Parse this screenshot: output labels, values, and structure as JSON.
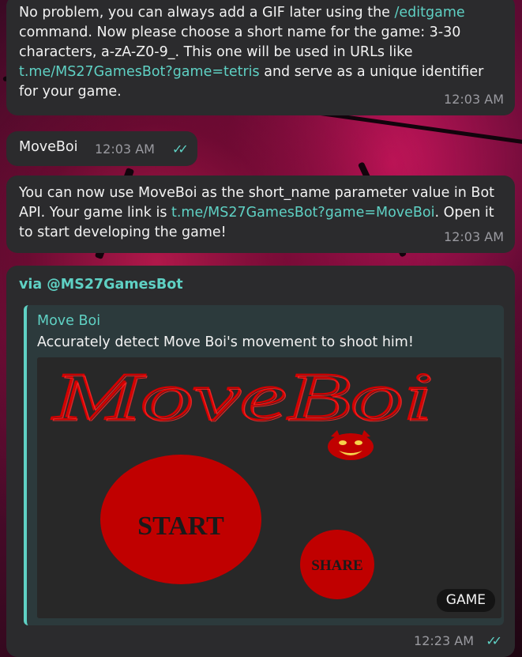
{
  "messages": [
    {
      "text_before": "No problem, you can always add a GIF later using the ",
      "link": "/editgame",
      "text_after": " command. Now please choose a short name for the game: 3-30 characters, a-zA-Z0-9_. This one will be used in URLs like ",
      "link2": "t.me/MS27GamesBot?game=tetris",
      "text_end": " and serve as a unique identifier for your game.",
      "time": "12:03 AM"
    },
    {
      "text": "MoveBoi",
      "time": "12:03 AM",
      "status": "read"
    },
    {
      "text_before": "You can now use MoveBoi as the short_name parameter value in Bot API. Your game link is ",
      "link": "t.me/MS27GamesBot?game=MoveBoi",
      "text_after": ". Open it to start developing the game!",
      "time": "12:03 AM"
    }
  ],
  "game_message": {
    "via": "via @MS27GamesBot",
    "title": "Move Boi",
    "description": "Accurately detect Move Boi's movement to shoot him!",
    "logo_text": "MoveBoi",
    "start_label": "START",
    "share_label": "SHARE",
    "badge": "GAME",
    "time": "12:23 AM",
    "status": "read"
  },
  "colors": {
    "accent": "#5fd1c4",
    "bubble": "#2b2b2d",
    "game_red": "#c00000"
  }
}
